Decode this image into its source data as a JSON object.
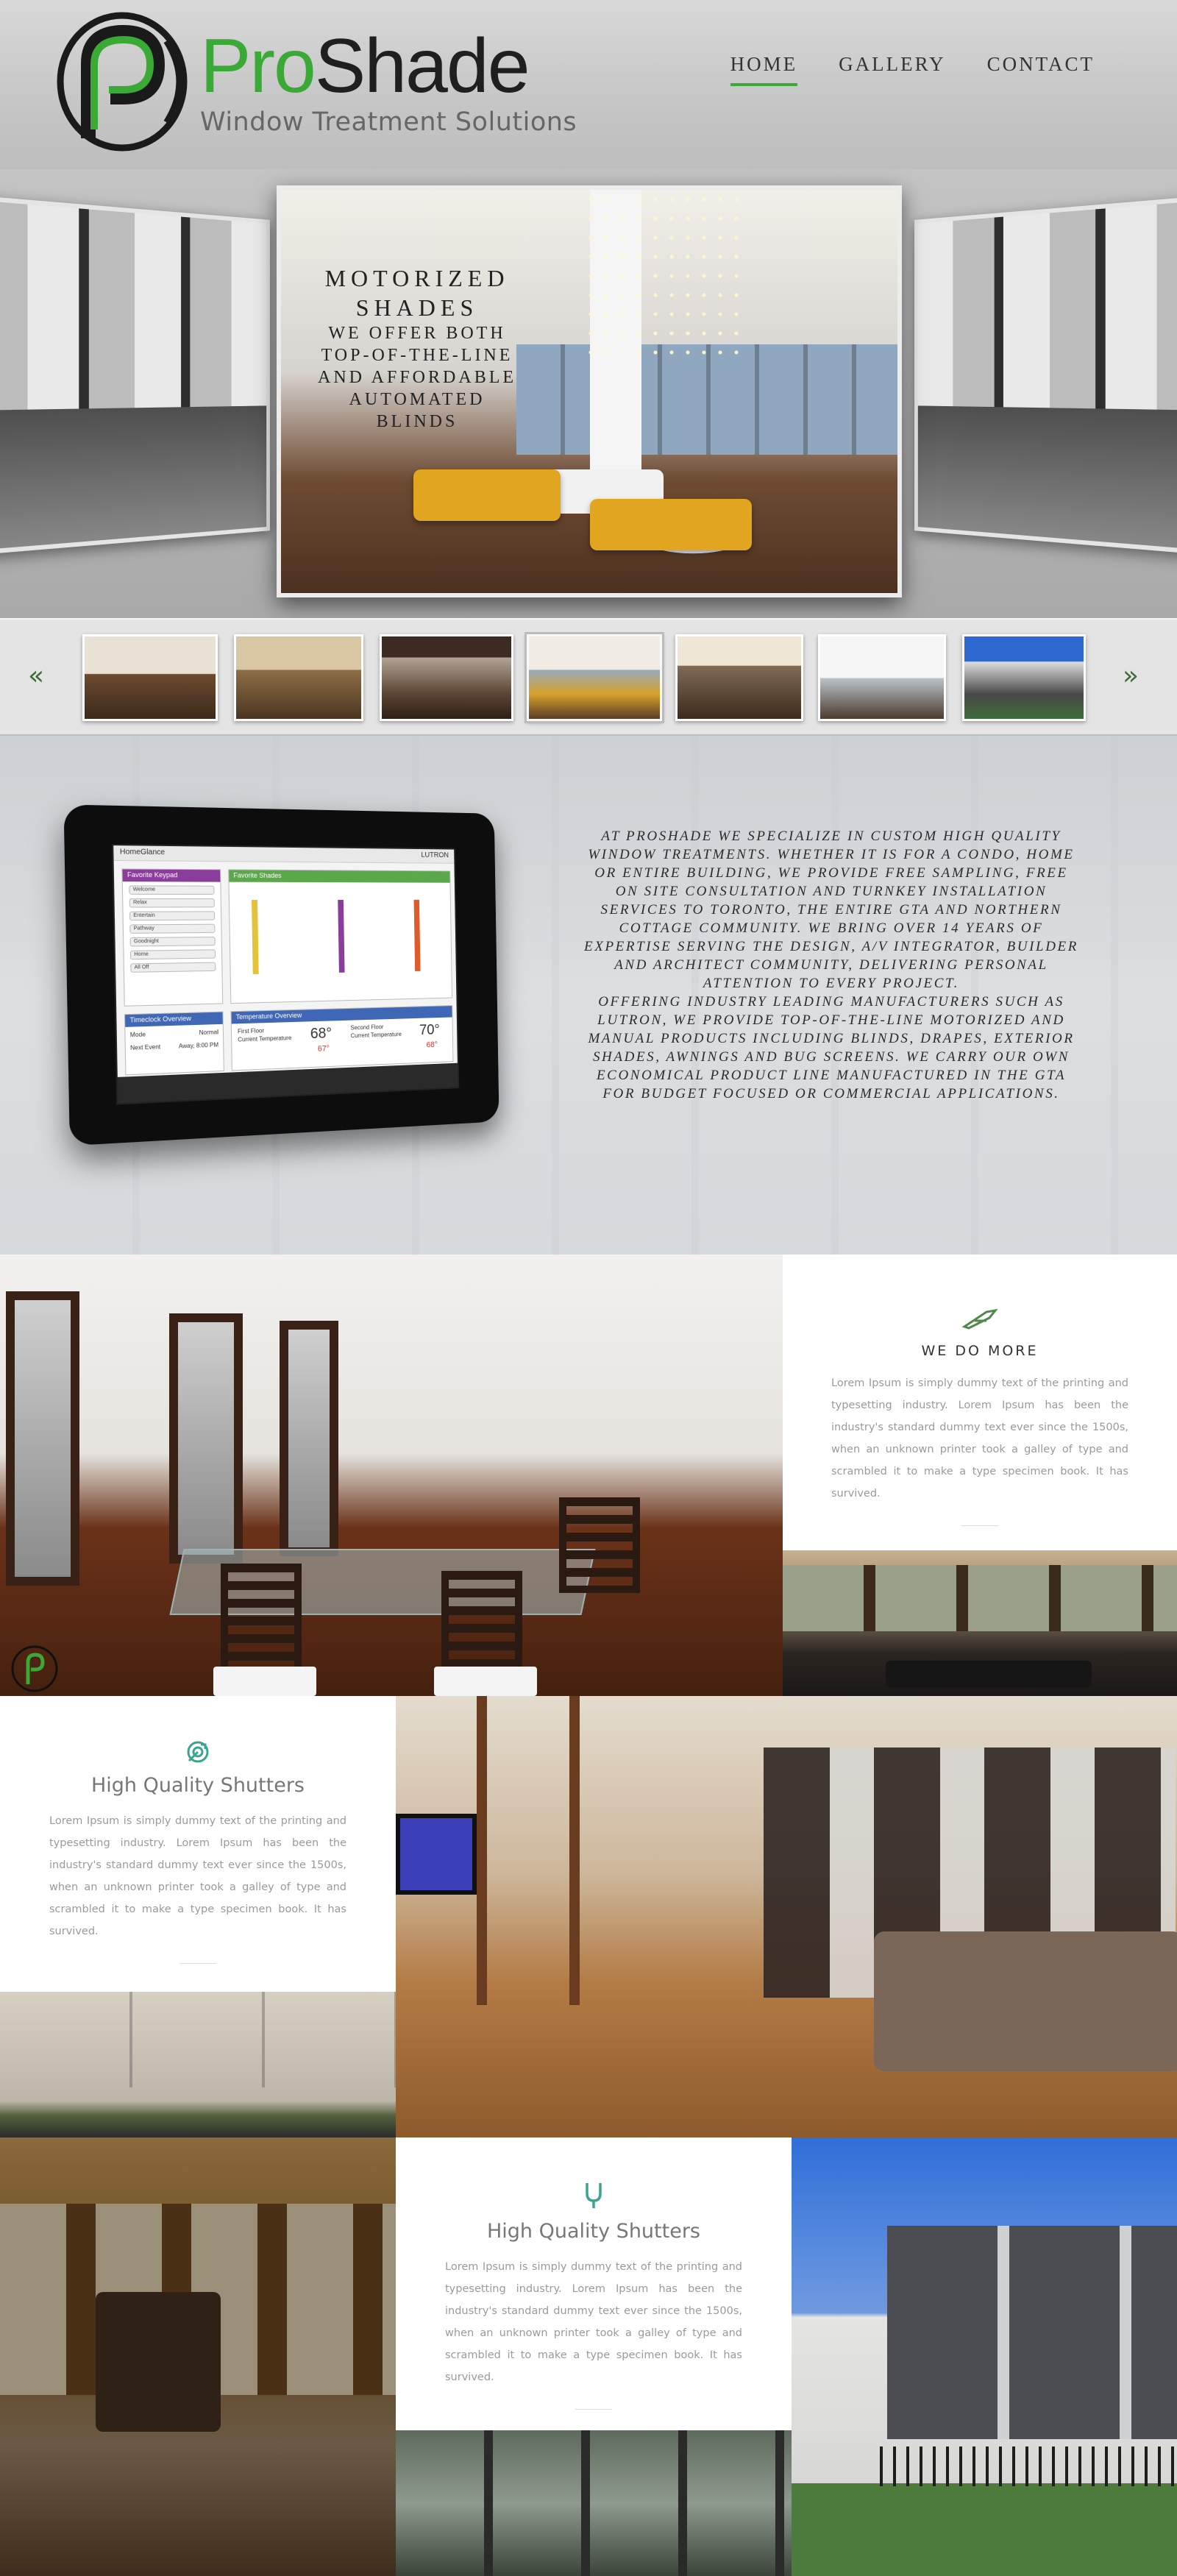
{
  "header": {
    "brand_pro": "Pro",
    "brand_shade": "Shade",
    "tagline": "Window Treatment Solutions",
    "logo_icon": "proshade-p-logo-icon",
    "nav": [
      {
        "label": "HOME",
        "active": true
      },
      {
        "label": "GALLERY",
        "active": false
      },
      {
        "label": "CONTACT",
        "active": false
      }
    ]
  },
  "hero": {
    "title_line1": "MOTORIZED",
    "title_line2": "SHADES",
    "subtitle_line1": "WE OFFER BOTH",
    "subtitle_line2": "TOP-OF-THE-LINE",
    "subtitle_line3": "AND AFFORDABLE",
    "subtitle_line4": "AUTOMATED",
    "subtitle_line5": "BLINDS"
  },
  "thumbnails": {
    "prev_icon": "double-chevron-left-icon",
    "next_icon": "double-chevron-right-icon",
    "prev_glyph": "«",
    "next_glyph": "»",
    "selected_index": 3,
    "count": 7
  },
  "about": {
    "paragraph1": "At ProShade we specialize in custom high quality window treatments. Whether it is for a condo, home or entire building, we provide free sampling, free on site consultation and turnkey installation services to Toronto, the entire GTA and Northern Cottage community. We bring over 14 years of expertise serving the design, A/V integrator, builder and architect community, delivering personal attention to every project.",
    "paragraph2": "Offering industry leading manufacturers such as Lutron, we provide top-of-the-line motorized and manual products including blinds, drapes, exterior shades, awnings and bug screens. We carry our own economical product line manufactured in the GTA for budget focused or commercial applications.",
    "tablet": {
      "app_name": "HomeGlance",
      "brand": "LUTRON",
      "panel1": "Favorite Keypad",
      "panel2": "Favorite Shades",
      "panel3": "Timeclock Overview",
      "panel4": "Temperature Overview",
      "buttons": [
        "Welcome",
        "Relax",
        "Entertain",
        "Pathway",
        "Goodnight",
        "Home",
        "All Off"
      ],
      "mode_label": "Mode",
      "mode_value": "Normal",
      "next_event_label": "Next Event",
      "next_event_value": "Away, 8:00 PM",
      "first_floor": "First Floor",
      "second_floor": "Second Floor",
      "current_temperature": "Current Temperature",
      "temp1": "68°",
      "temp2": "70°",
      "setpoint1": "67°",
      "setpoint2": "68°"
    }
  },
  "cards": [
    {
      "icon": "drafting-compass-icon",
      "heading": "WE DO MORE",
      "body": "Lorem Ipsum is simply dummy text of the printing and typesetting industry. Lorem Ipsum has been the industry's standard dummy text ever since the 1500s, when an unknown printer took a galley of type and scrambled it to make a type specimen book. It has survived."
    },
    {
      "icon": "target-icon",
      "heading": "High Quality Shutters",
      "body": "Lorem Ipsum is simply dummy text of the printing and typesetting industry. Lorem Ipsum has been the industry's standard dummy text ever since the 1500s, when an unknown printer took a galley of type and scrambled it to make a type specimen book. It has survived."
    },
    {
      "icon": "tuning-fork-icon",
      "heading": "High Quality Shutters",
      "body": "Lorem Ipsum is simply dummy text of the printing and typesetting industry. Lorem Ipsum has been the industry's standard dummy text ever since the 1500s, when an unknown printer took a galley of type and scrambled it to make a type specimen book. It has survived."
    }
  ],
  "colors": {
    "brand_green": "#3aa936",
    "icon_teal": "#3aa58f",
    "icon_green": "#4f8a4c"
  }
}
